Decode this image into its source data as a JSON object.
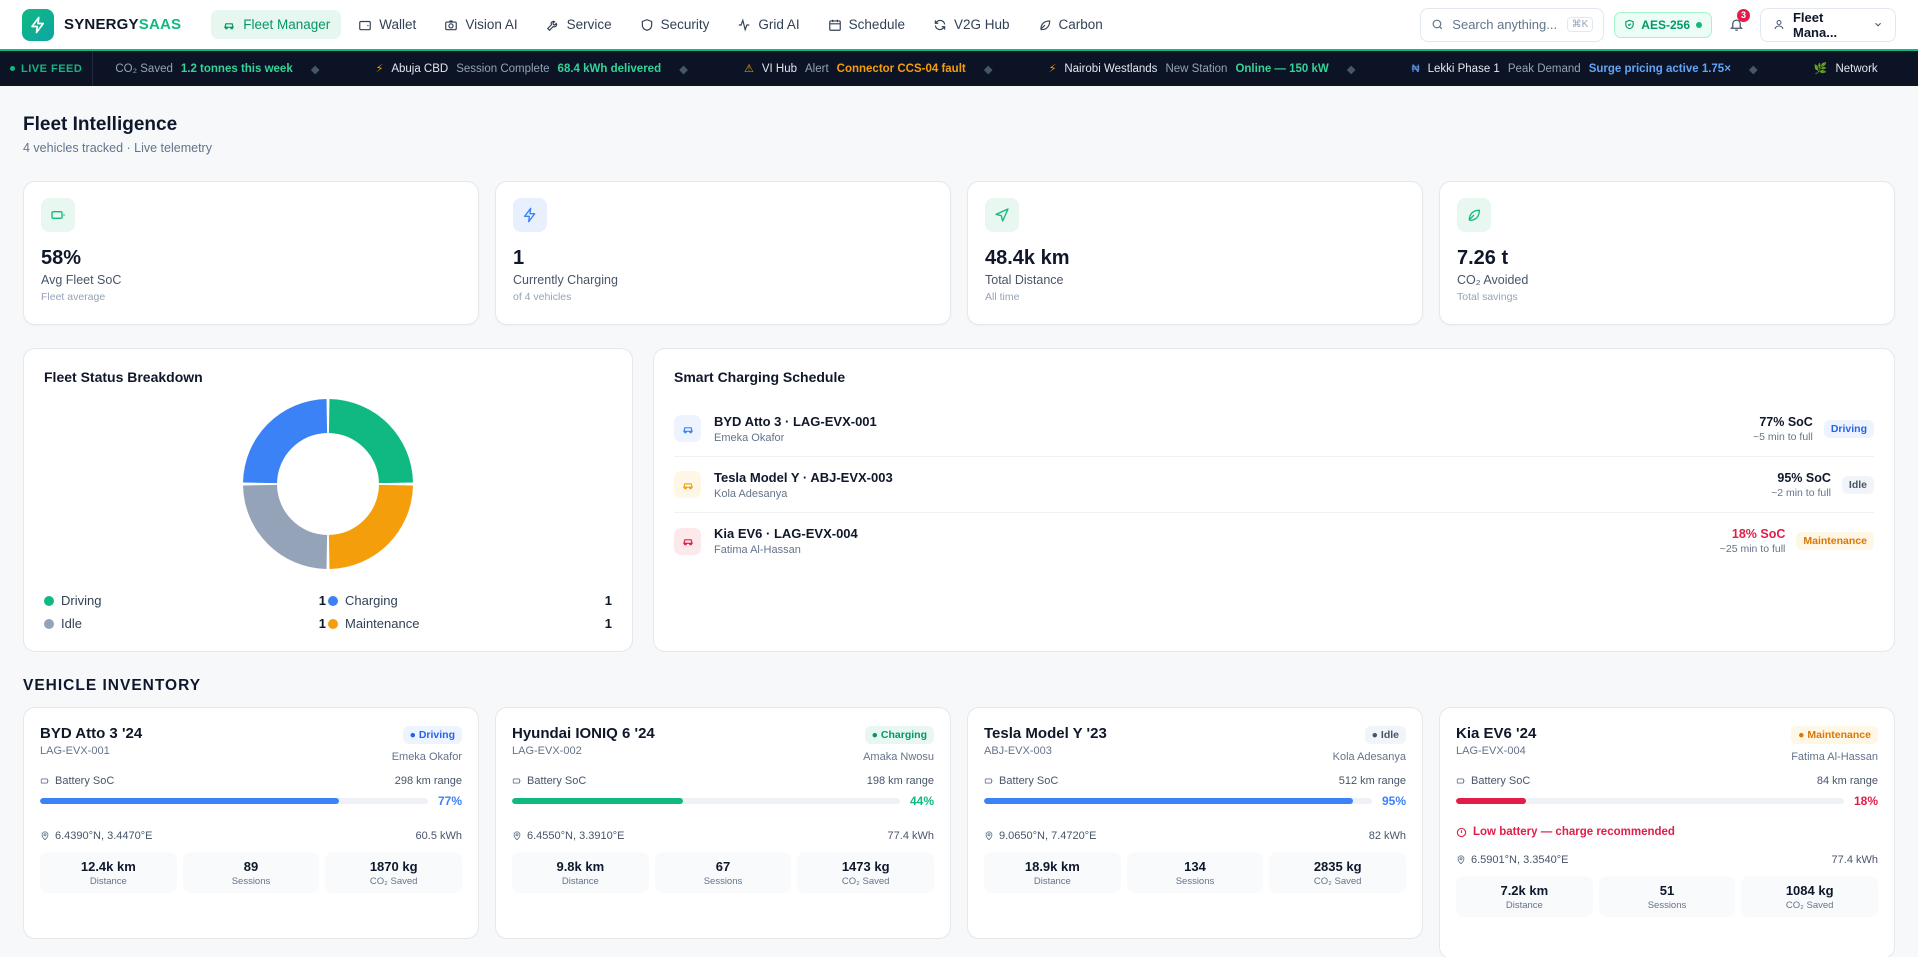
{
  "brand": {
    "name_a": "SYNERGY",
    "name_b": "SAAS"
  },
  "nav": [
    {
      "label": "Fleet Manager",
      "icon": "car-icon",
      "active": true
    },
    {
      "label": "Wallet",
      "icon": "wallet-icon"
    },
    {
      "label": "Vision AI",
      "icon": "camera-icon"
    },
    {
      "label": "Service",
      "icon": "wrench-icon"
    },
    {
      "label": "Security",
      "icon": "shield-icon"
    },
    {
      "label": "Grid AI",
      "icon": "activity-icon"
    },
    {
      "label": "Schedule",
      "icon": "calendar-icon"
    },
    {
      "label": "V2G Hub",
      "icon": "refresh-icon"
    },
    {
      "label": "Carbon",
      "icon": "leaf-icon"
    }
  ],
  "search": {
    "placeholder": "Search anything...",
    "shortcut": "⌘K"
  },
  "security_badge": "AES-256",
  "notifications": {
    "count": "3"
  },
  "user": {
    "label": "Fleet Mana..."
  },
  "ticker": {
    "live_label": "LIVE FEED",
    "items": [
      {
        "place": "",
        "label": "CO₂ Saved",
        "value": "1.2 tonnes this week",
        "tone": "green"
      },
      {
        "place": "Abuja CBD",
        "label": "Session Complete",
        "value": "68.4 kWh delivered",
        "tone": "green"
      },
      {
        "place": "VI Hub",
        "label": "Alert",
        "value": "Connector CCS-04 fault",
        "tone": "amber"
      },
      {
        "place": "Nairobi Westlands",
        "label": "New Station",
        "value": "Online — 150 kW",
        "tone": "green"
      },
      {
        "place": "Lekki Phase 1",
        "label": "Peak Demand",
        "value": "Surge pricing active 1.75×",
        "tone": "blue"
      },
      {
        "place": "Network",
        "label": "",
        "value": "",
        "tone": "green"
      }
    ]
  },
  "page": {
    "title": "Fleet Intelligence",
    "subtitle": "4 vehicles tracked · Live telemetry"
  },
  "kpis": [
    {
      "value": "58%",
      "label": "Avg Fleet SoC",
      "sub": "Fleet average",
      "icon": "battery-icon"
    },
    {
      "value": "1",
      "label": "Currently Charging",
      "sub": "of 4 vehicles",
      "icon": "bolt-icon"
    },
    {
      "value": "48.4k km",
      "label": "Total Distance",
      "sub": "All time",
      "icon": "navigation-icon"
    },
    {
      "value": "7.26 t",
      "label": "CO₂ Avoided",
      "sub": "Total savings",
      "icon": "leaf-icon"
    }
  ],
  "status_breakdown": {
    "title": "Fleet Status Breakdown",
    "colors": {
      "Driving": "#10b981",
      "Charging": "#3b82f6",
      "Idle": "#94a3b8",
      "Maintenance": "#f59e0b"
    },
    "items": [
      {
        "label": "Driving",
        "count": "1"
      },
      {
        "label": "Charging",
        "count": "1"
      },
      {
        "label": "Idle",
        "count": "1"
      },
      {
        "label": "Maintenance",
        "count": "1"
      }
    ]
  },
  "schedule": {
    "title": "Smart Charging Schedule",
    "rows": [
      {
        "name": "BYD Atto 3 · LAG-EVX-001",
        "driver": "Emeka Okafor",
        "soc": "77% SoC",
        "eta": "~5 min to full",
        "status": "Driving",
        "tone": "blue"
      },
      {
        "name": "Tesla Model Y · ABJ-EVX-003",
        "driver": "Kola Adesanya",
        "soc": "95% SoC",
        "eta": "~2 min to full",
        "status": "Idle",
        "tone": "gray"
      },
      {
        "name": "Kia EV6 · LAG-EVX-004",
        "driver": "Fatima Al-Hassan",
        "soc": "18% SoC",
        "eta": "~25 min to full",
        "status": "Maintenance",
        "tone": "amber"
      }
    ]
  },
  "inventory": {
    "title": "VEHICLE INVENTORY",
    "vehicles": [
      {
        "name": "BYD Atto 3 '24",
        "plate": "LAG-EVX-001",
        "status": "Driving",
        "driver": "Emeka Okafor",
        "soc_label": "Battery SoC",
        "range": "298 km range",
        "soc": 77,
        "soc_text": "77%",
        "location": "6.4390°N, 3.4470°E",
        "capacity": "60.5 kWh",
        "distance": "12.4k km",
        "sessions": "89",
        "co2": "1870 kg",
        "warning": ""
      },
      {
        "name": "Hyundai IONIQ 6 '24",
        "plate": "LAG-EVX-002",
        "status": "Charging",
        "driver": "Amaka Nwosu",
        "soc_label": "Battery SoC",
        "range": "198 km range",
        "soc": 44,
        "soc_text": "44%",
        "location": "6.4550°N, 3.3910°E",
        "capacity": "77.4 kWh",
        "distance": "9.8k km",
        "sessions": "67",
        "co2": "1473 kg",
        "warning": ""
      },
      {
        "name": "Tesla Model Y '23",
        "plate": "ABJ-EVX-003",
        "status": "Idle",
        "driver": "Kola Adesanya",
        "soc_label": "Battery SoC",
        "range": "512 km range",
        "soc": 95,
        "soc_text": "95%",
        "location": "9.0650°N, 7.4720°E",
        "capacity": "82 kWh",
        "distance": "18.9k km",
        "sessions": "134",
        "co2": "2835 kg",
        "warning": ""
      },
      {
        "name": "Kia EV6 '24",
        "plate": "LAG-EVX-004",
        "status": "Maintenance",
        "driver": "Fatima Al-Hassan",
        "soc_label": "Battery SoC",
        "range": "84 km range",
        "soc": 18,
        "soc_text": "18%",
        "location": "6.5901°N, 3.3540°E",
        "capacity": "77.4 kWh",
        "distance": "7.2k km",
        "sessions": "51",
        "co2": "1084 kg",
        "warning": "Low battery — charge recommended"
      }
    ],
    "stat_labels": {
      "distance": "Distance",
      "sessions": "Sessions",
      "co2": "CO₂ Saved"
    }
  }
}
